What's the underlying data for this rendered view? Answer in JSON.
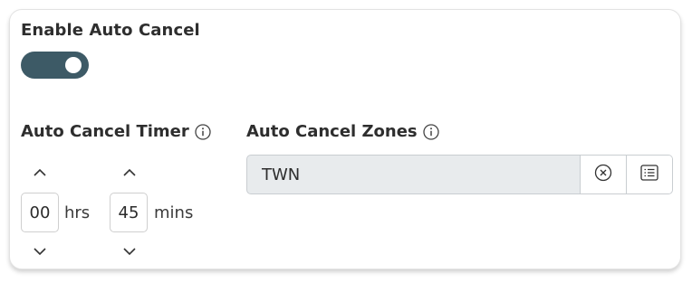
{
  "auto_cancel": {
    "title": "Enable Auto Cancel",
    "enabled": true,
    "toggle_color": "#3d5a66"
  },
  "timer": {
    "label": "Auto Cancel Timer",
    "info_icon": "info-icon",
    "hours_value": "00",
    "hours_unit": "hrs",
    "minutes_value": "45",
    "minutes_unit": "mins"
  },
  "zones": {
    "label": "Auto Cancel Zones",
    "info_icon": "info-icon",
    "value": "TWN",
    "clear_icon": "clear-circle-x-icon",
    "list_icon": "list-icon"
  }
}
